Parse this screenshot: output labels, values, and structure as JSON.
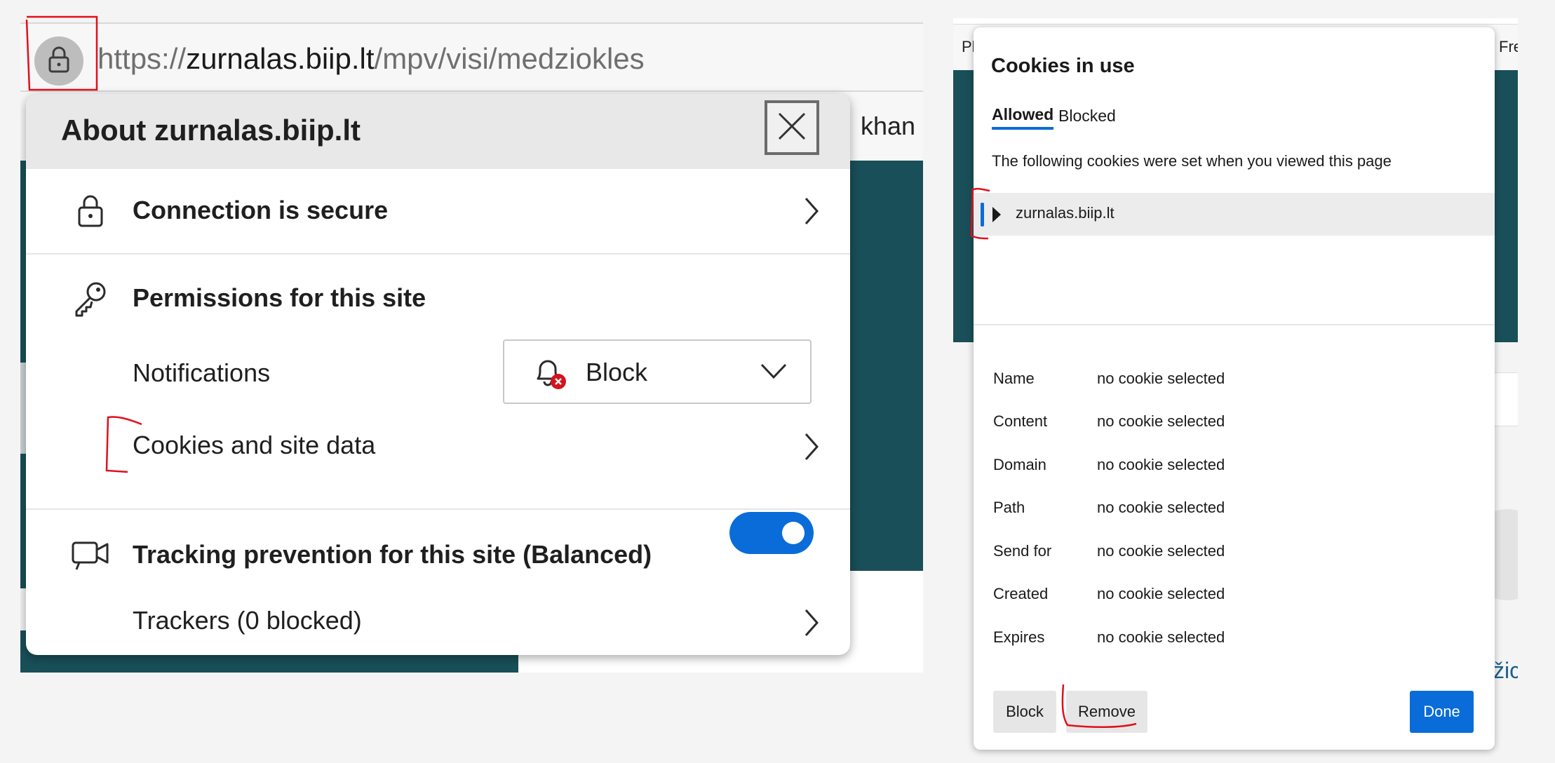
{
  "left": {
    "address_bar": {
      "url_scheme": "https://",
      "url_host": "zurnalas.biip.lt",
      "url_path": "/mpv/visi/medziokles"
    },
    "background_text": "khan",
    "about_panel": {
      "title": "About zurnalas.biip.lt",
      "connection_label": "Connection is secure",
      "permissions_label": "Permissions for this site",
      "notifications_label": "Notifications",
      "notifications_value": "Block",
      "cookies_label": "Cookies and site data",
      "tracking_label": "Tracking prevention for this site (Balanced)",
      "tracking_enabled": true,
      "trackers_label": "Trackers (0 blocked)"
    }
  },
  "right": {
    "background_text_left": "Pl",
    "background_text_right": "Fre",
    "background_text_bottom": "žic",
    "cookies_dialog": {
      "title": "Cookies in use",
      "tabs": [
        "Allowed",
        "Blocked"
      ],
      "active_tab": "Allowed",
      "description": "The following cookies were set when you viewed this page",
      "site_entry": "zurnalas.biip.lt",
      "details": [
        {
          "label": "Name",
          "value": "no cookie selected"
        },
        {
          "label": "Content",
          "value": "no cookie selected"
        },
        {
          "label": "Domain",
          "value": "no cookie selected"
        },
        {
          "label": "Path",
          "value": "no cookie selected"
        },
        {
          "label": "Send for",
          "value": "no cookie selected"
        },
        {
          "label": "Created",
          "value": "no cookie selected"
        },
        {
          "label": "Expires",
          "value": "no cookie selected"
        }
      ],
      "buttons": {
        "block": "Block",
        "remove": "Remove",
        "done": "Done"
      }
    }
  },
  "colors": {
    "accent_blue": "#0a6cd8",
    "teal_background": "#194f58",
    "annotation_red": "#e0101a"
  }
}
